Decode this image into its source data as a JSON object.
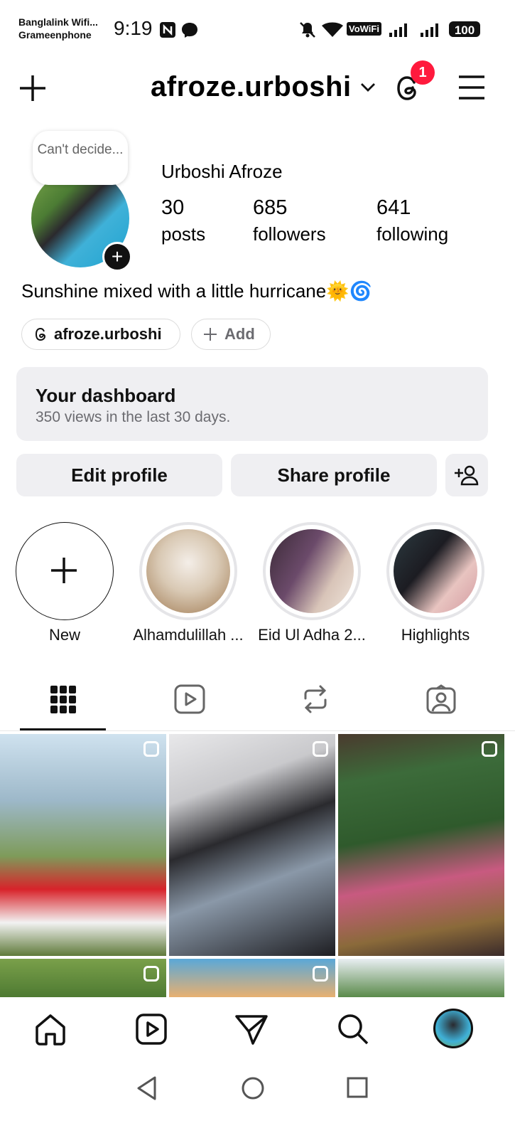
{
  "status_bar": {
    "carrier_1": "Banglalink Wifi...",
    "carrier_2": "Grameenphone",
    "time": "9:19",
    "volte": "VoWiFi",
    "battery": "100"
  },
  "header": {
    "username": "afroze.urboshi",
    "threads_badge": "1"
  },
  "profile": {
    "note": "Can't decide...",
    "full_name": "Urboshi Afroze",
    "stats": [
      {
        "value": "30",
        "label": "posts"
      },
      {
        "value": "685",
        "label": "followers"
      },
      {
        "value": "641",
        "label": "following"
      }
    ],
    "bio": "Sunshine mixed with a little hurricane🌞🌀",
    "threads_link": "afroze.urboshi",
    "add_label": "Add"
  },
  "dashboard": {
    "title": "Your dashboard",
    "subtitle": "350 views in the last 30 days."
  },
  "actions": {
    "edit": "Edit profile",
    "share": "Share profile"
  },
  "highlights": [
    {
      "label": "New"
    },
    {
      "label": "Alhamdulillah ..."
    },
    {
      "label": "Eid Ul Adha 2..."
    },
    {
      "label": "Highlights"
    }
  ],
  "tabs": [
    "grid-icon",
    "reels-icon",
    "reposts-icon",
    "tagged-icon"
  ],
  "nav": [
    "home-icon",
    "reels-icon",
    "direct-icon",
    "search-icon",
    "profile-avatar"
  ],
  "colors": {
    "badge": "#ff1a3d",
    "surface": "#efeff2"
  }
}
